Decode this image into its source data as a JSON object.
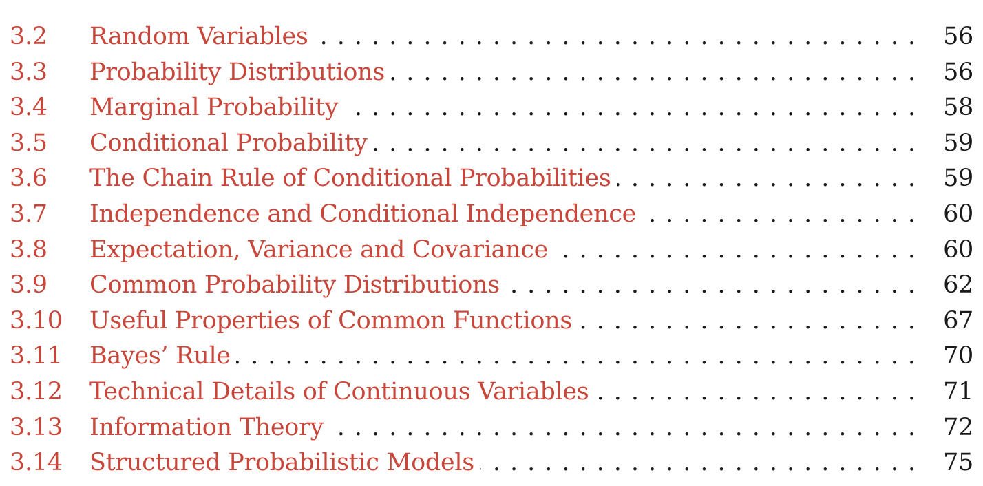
{
  "colors": {
    "link": "#c9473a",
    "text": "#1a1a1a"
  },
  "leader": "........................................................................................",
  "toc": {
    "entries": [
      {
        "number": "3.2",
        "title": "Random Variables",
        "page": "56"
      },
      {
        "number": "3.3",
        "title": "Probability Distributions",
        "page": "56"
      },
      {
        "number": "3.4",
        "title": "Marginal Probability",
        "page": "58"
      },
      {
        "number": "3.5",
        "title": "Conditional Probability",
        "page": "59"
      },
      {
        "number": "3.6",
        "title": "The Chain Rule of Conditional Probabilities",
        "page": "59"
      },
      {
        "number": "3.7",
        "title": "Independence and Conditional Independence",
        "page": "60"
      },
      {
        "number": "3.8",
        "title": "Expectation, Variance and Covariance",
        "page": "60"
      },
      {
        "number": "3.9",
        "title": "Common Probability Distributions",
        "page": "62"
      },
      {
        "number": "3.10",
        "title": "Useful Properties of Common Functions",
        "page": "67"
      },
      {
        "number": "3.11",
        "title": "Bayes’ Rule",
        "page": "70"
      },
      {
        "number": "3.12",
        "title": "Technical Details of Continuous Variables",
        "page": "71"
      },
      {
        "number": "3.13",
        "title": "Information Theory",
        "page": "72"
      },
      {
        "number": "3.14",
        "title": "Structured Probabilistic Models",
        "page": "75"
      }
    ]
  }
}
